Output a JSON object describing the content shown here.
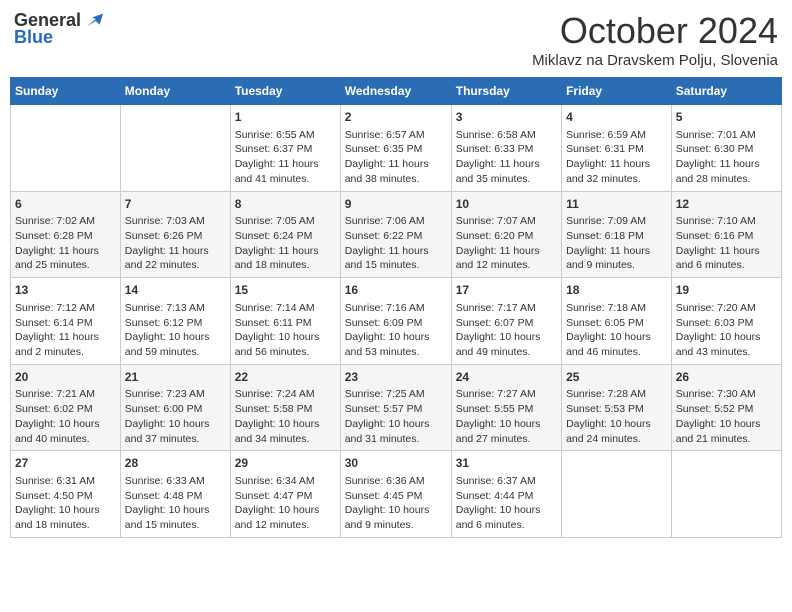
{
  "header": {
    "logo_general": "General",
    "logo_blue": "Blue",
    "month_title": "October 2024",
    "subtitle": "Miklavz na Dravskem Polju, Slovenia"
  },
  "weekdays": [
    "Sunday",
    "Monday",
    "Tuesday",
    "Wednesday",
    "Thursday",
    "Friday",
    "Saturday"
  ],
  "weeks": [
    [
      {
        "day": "",
        "detail": ""
      },
      {
        "day": "",
        "detail": ""
      },
      {
        "day": "1",
        "detail": "Sunrise: 6:55 AM\nSunset: 6:37 PM\nDaylight: 11 hours and 41 minutes."
      },
      {
        "day": "2",
        "detail": "Sunrise: 6:57 AM\nSunset: 6:35 PM\nDaylight: 11 hours and 38 minutes."
      },
      {
        "day": "3",
        "detail": "Sunrise: 6:58 AM\nSunset: 6:33 PM\nDaylight: 11 hours and 35 minutes."
      },
      {
        "day": "4",
        "detail": "Sunrise: 6:59 AM\nSunset: 6:31 PM\nDaylight: 11 hours and 32 minutes."
      },
      {
        "day": "5",
        "detail": "Sunrise: 7:01 AM\nSunset: 6:30 PM\nDaylight: 11 hours and 28 minutes."
      }
    ],
    [
      {
        "day": "6",
        "detail": "Sunrise: 7:02 AM\nSunset: 6:28 PM\nDaylight: 11 hours and 25 minutes."
      },
      {
        "day": "7",
        "detail": "Sunrise: 7:03 AM\nSunset: 6:26 PM\nDaylight: 11 hours and 22 minutes."
      },
      {
        "day": "8",
        "detail": "Sunrise: 7:05 AM\nSunset: 6:24 PM\nDaylight: 11 hours and 18 minutes."
      },
      {
        "day": "9",
        "detail": "Sunrise: 7:06 AM\nSunset: 6:22 PM\nDaylight: 11 hours and 15 minutes."
      },
      {
        "day": "10",
        "detail": "Sunrise: 7:07 AM\nSunset: 6:20 PM\nDaylight: 11 hours and 12 minutes."
      },
      {
        "day": "11",
        "detail": "Sunrise: 7:09 AM\nSunset: 6:18 PM\nDaylight: 11 hours and 9 minutes."
      },
      {
        "day": "12",
        "detail": "Sunrise: 7:10 AM\nSunset: 6:16 PM\nDaylight: 11 hours and 6 minutes."
      }
    ],
    [
      {
        "day": "13",
        "detail": "Sunrise: 7:12 AM\nSunset: 6:14 PM\nDaylight: 11 hours and 2 minutes."
      },
      {
        "day": "14",
        "detail": "Sunrise: 7:13 AM\nSunset: 6:12 PM\nDaylight: 10 hours and 59 minutes."
      },
      {
        "day": "15",
        "detail": "Sunrise: 7:14 AM\nSunset: 6:11 PM\nDaylight: 10 hours and 56 minutes."
      },
      {
        "day": "16",
        "detail": "Sunrise: 7:16 AM\nSunset: 6:09 PM\nDaylight: 10 hours and 53 minutes."
      },
      {
        "day": "17",
        "detail": "Sunrise: 7:17 AM\nSunset: 6:07 PM\nDaylight: 10 hours and 49 minutes."
      },
      {
        "day": "18",
        "detail": "Sunrise: 7:18 AM\nSunset: 6:05 PM\nDaylight: 10 hours and 46 minutes."
      },
      {
        "day": "19",
        "detail": "Sunrise: 7:20 AM\nSunset: 6:03 PM\nDaylight: 10 hours and 43 minutes."
      }
    ],
    [
      {
        "day": "20",
        "detail": "Sunrise: 7:21 AM\nSunset: 6:02 PM\nDaylight: 10 hours and 40 minutes."
      },
      {
        "day": "21",
        "detail": "Sunrise: 7:23 AM\nSunset: 6:00 PM\nDaylight: 10 hours and 37 minutes."
      },
      {
        "day": "22",
        "detail": "Sunrise: 7:24 AM\nSunset: 5:58 PM\nDaylight: 10 hours and 34 minutes."
      },
      {
        "day": "23",
        "detail": "Sunrise: 7:25 AM\nSunset: 5:57 PM\nDaylight: 10 hours and 31 minutes."
      },
      {
        "day": "24",
        "detail": "Sunrise: 7:27 AM\nSunset: 5:55 PM\nDaylight: 10 hours and 27 minutes."
      },
      {
        "day": "25",
        "detail": "Sunrise: 7:28 AM\nSunset: 5:53 PM\nDaylight: 10 hours and 24 minutes."
      },
      {
        "day": "26",
        "detail": "Sunrise: 7:30 AM\nSunset: 5:52 PM\nDaylight: 10 hours and 21 minutes."
      }
    ],
    [
      {
        "day": "27",
        "detail": "Sunrise: 6:31 AM\nSunset: 4:50 PM\nDaylight: 10 hours and 18 minutes."
      },
      {
        "day": "28",
        "detail": "Sunrise: 6:33 AM\nSunset: 4:48 PM\nDaylight: 10 hours and 15 minutes."
      },
      {
        "day": "29",
        "detail": "Sunrise: 6:34 AM\nSunset: 4:47 PM\nDaylight: 10 hours and 12 minutes."
      },
      {
        "day": "30",
        "detail": "Sunrise: 6:36 AM\nSunset: 4:45 PM\nDaylight: 10 hours and 9 minutes."
      },
      {
        "day": "31",
        "detail": "Sunrise: 6:37 AM\nSunset: 4:44 PM\nDaylight: 10 hours and 6 minutes."
      },
      {
        "day": "",
        "detail": ""
      },
      {
        "day": "",
        "detail": ""
      }
    ]
  ]
}
